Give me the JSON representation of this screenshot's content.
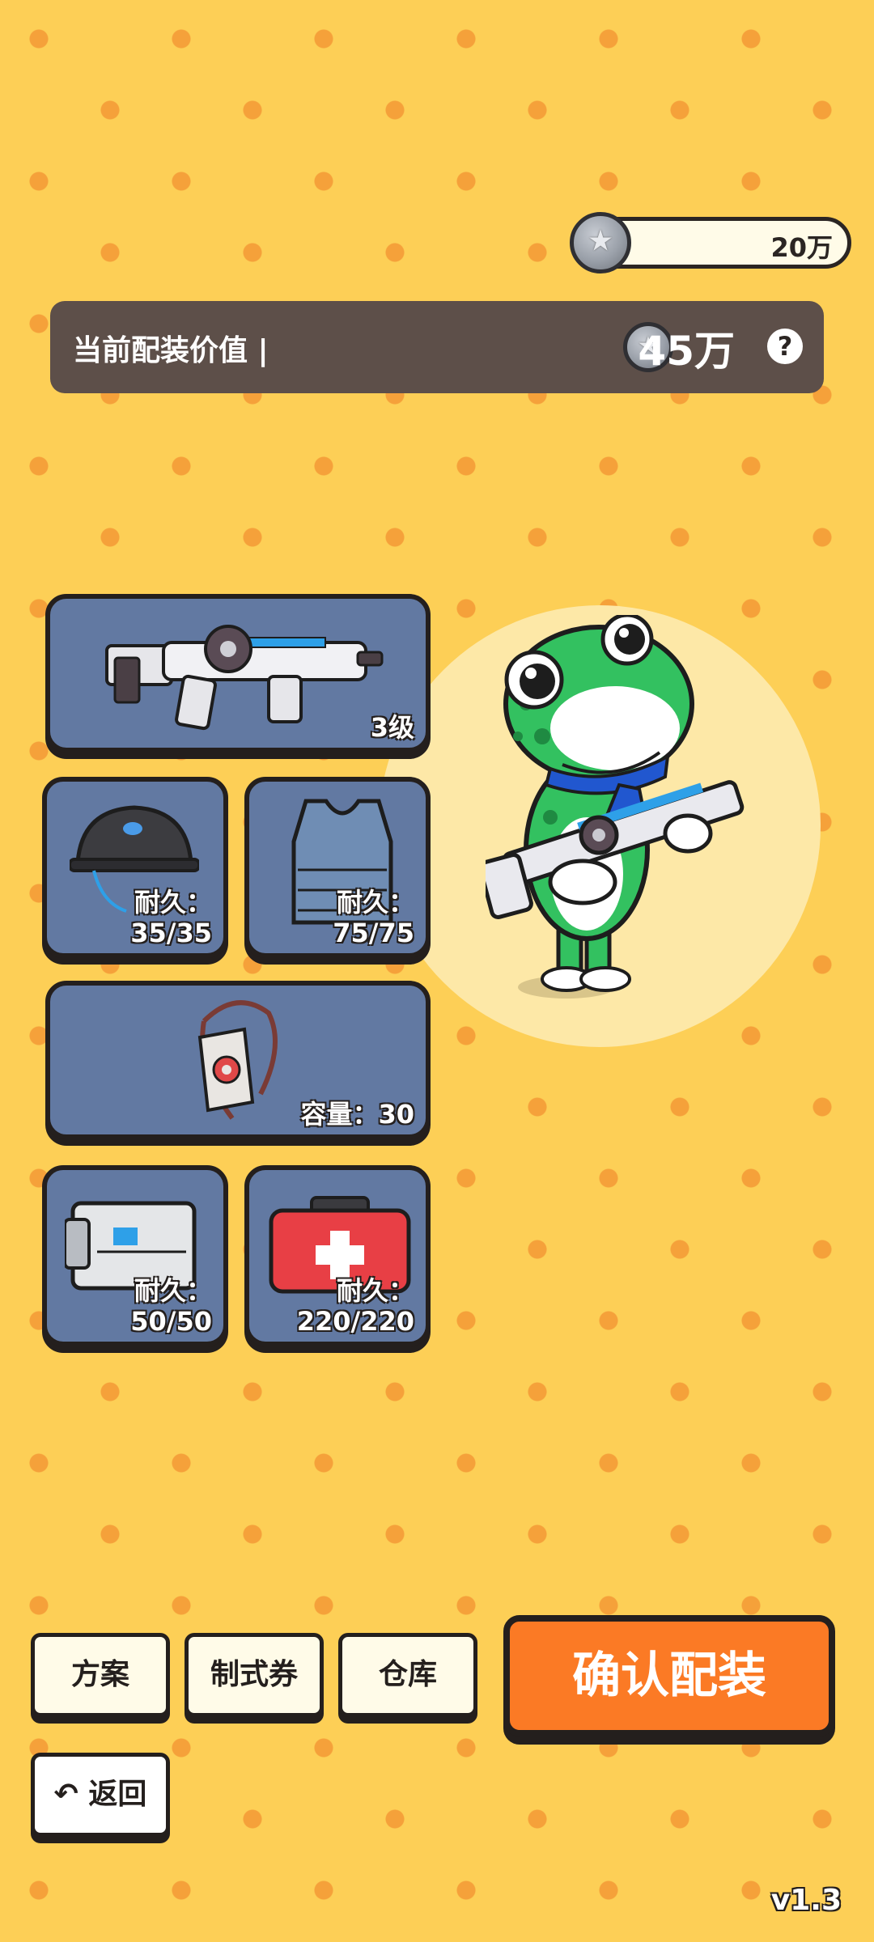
{
  "header": {
    "currency_amount": "20万",
    "equipment_value_label": "当前配装价值 |",
    "equipment_value_amount": "45万",
    "help_label": "?"
  },
  "slots": {
    "weapon": {
      "item": "rifle",
      "level": "3级"
    },
    "helmet": {
      "durability_label": "耐久：",
      "durability_value": "35/35"
    },
    "armor": {
      "durability_label": "耐久：",
      "durability_value": "75/75"
    },
    "backpack": {
      "capacity_text": "容量：30"
    },
    "case": {
      "durability_label": "耐久：",
      "durability_value": "50/50"
    },
    "medkit": {
      "durability_label": "耐久：",
      "durability_value": "220/220"
    }
  },
  "buttons": {
    "plan": "方案",
    "voucher": "制式券",
    "warehouse": "仓库",
    "confirm": "确认配装",
    "back_icon": "↶",
    "back": "返回"
  },
  "icons": [
    "coin-icon",
    "help-icon",
    "rifle-icon",
    "helmet-icon",
    "vest-icon",
    "backpack-icon",
    "case-icon",
    "medkit-icon",
    "back-arrow-icon"
  ],
  "version": "v1.3",
  "colors": {
    "background": "#fdcf56",
    "dots": "#f5a13a",
    "slot": "#6279a2",
    "confirm": "#fb7a25",
    "value_bar": "#5d4f49"
  }
}
